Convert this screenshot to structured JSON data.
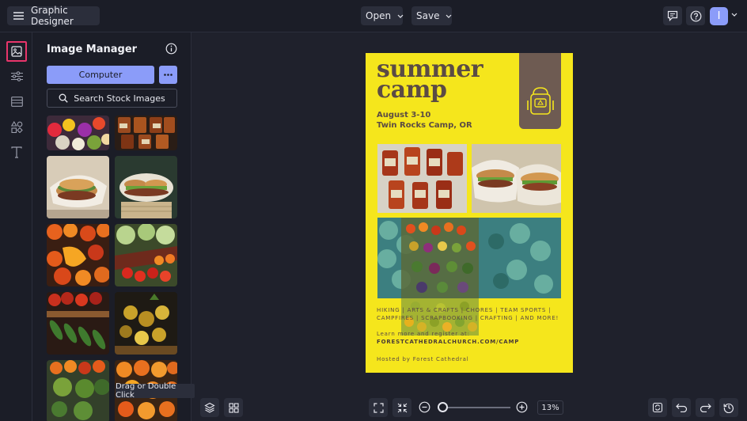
{
  "app": {
    "title": "Graphic Designer"
  },
  "topbar": {
    "open_label": "Open",
    "save_label": "Save",
    "avatar_initial": "I"
  },
  "panel": {
    "title": "Image Manager",
    "computer_label": "Computer",
    "search_label": "Search Stock Images",
    "tooltip": "Drag or Double Click"
  },
  "poster": {
    "title_line1": "summer",
    "title_line2": "camp",
    "dates": "August 3-10",
    "location": "Twin Rocks Camp, OR",
    "activities_line1": "HIKING | ARTS & CRAFTS | CHORES | TEAM SPORTS |",
    "activities_line2": "CAMPFIRES | SCRAPBOOKING | CRAFTING | AND MORE!",
    "learn_more": "Learn more and register at:",
    "website": "FORESTCATHEDRALCHURCH.COM/CAMP",
    "host": "Hosted by Forest Cathedral"
  },
  "bottombar": {
    "zoom_level": "13%"
  },
  "colors": {
    "accent": "#8b9cf9",
    "active_rail": "#e8356b",
    "poster_bg": "#f5e61c",
    "poster_text": "#5b4b44"
  },
  "icons": {
    "menu": "hamburger-icon",
    "comments": "comment-icon",
    "help": "help-icon",
    "images": "image-icon",
    "adjust": "sliders-icon",
    "layout": "layout-icon",
    "shapes": "shapes-icon",
    "text": "text-icon"
  }
}
